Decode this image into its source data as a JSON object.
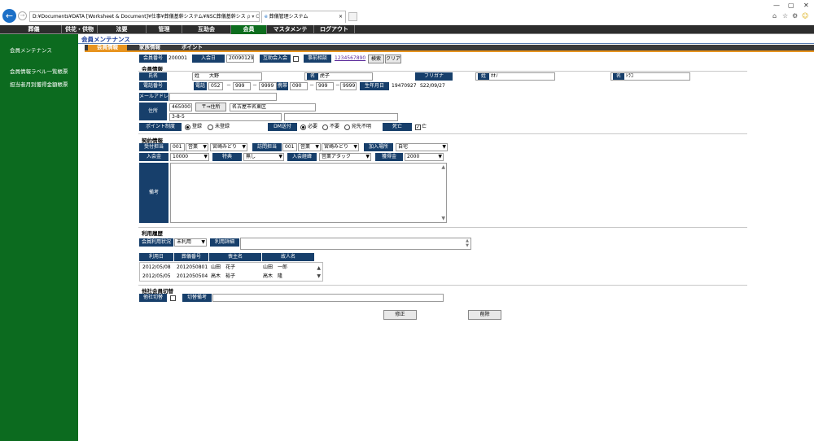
{
  "browser": {
    "address": "D:¥Documents¥DATA [Worksheet & Document]¥仕事¥葬儀基幹システム¥NSC葬儀基幹シス",
    "addr_icons": "ρ ▾ C",
    "tab_title": "葬儀管理システム",
    "tab_close": "×",
    "win_min": "—",
    "win_max": "▢",
    "win_close": "✕",
    "toolbar_icons": [
      "⌂",
      "☆",
      "⚙",
      "☺"
    ]
  },
  "menu": [
    "葬儀",
    "供花・供物",
    "法要",
    "管理",
    "互助会",
    "会員",
    "マスタメンテ",
    "ログアウト"
  ],
  "sidebar": [
    "会員メンテナンス",
    "会員情報ラベル一覧帳票",
    "担当者月別獲得金額帳票"
  ],
  "page": {
    "title": "会員メンテナンス",
    "subtabs": [
      "会員情報",
      "家族情報",
      "ポイント"
    ]
  },
  "header": {
    "member_no_label": "会員番号",
    "member_no": "200001",
    "join_date_label": "入会日",
    "join_date": "20090129",
    "mutual_label": "互助会入会",
    "pre_consult_label": "事前相談",
    "pre_consult_link": "1234567890",
    "search_btn": "検索",
    "clear_btn": "クリア"
  },
  "member": {
    "section": "会員情報",
    "name_label": "氏名",
    "sei_label": "姓",
    "sei": "大野",
    "mei_label": "名",
    "mei": "虎子",
    "kana_label": "フリガナ",
    "kana_sei_label": "姓",
    "kana_sei": "ｵｵﾉ",
    "kana_mei_label": "名",
    "kana_mei": "ﾄﾗｺ",
    "phone_label": "電話番号",
    "tel_label": "電話",
    "tel": [
      "052",
      "999",
      "9999"
    ],
    "mobile_label": "携帯",
    "mobile": [
      "090",
      "999",
      "9999"
    ],
    "dash": "－",
    "birth_label": "生年月日",
    "birth": "19470927",
    "birth_wareki": "S22/09/27",
    "mail_label": "メールアドレス",
    "address_label": "住所",
    "zip": "4650001",
    "zip_btn": "〒⇒住所",
    "addr1": "名古屋市名東区",
    "addr2": "3-8-5",
    "point_label": "ポイント制度",
    "point_opts": [
      "登録",
      "未登録"
    ],
    "dm_label": "DM送付",
    "dm_opts": [
      "必要",
      "不要",
      "宛先不明"
    ],
    "death_label": "死亡",
    "death_text": "亡"
  },
  "contract": {
    "section": "契約情報",
    "reception_label": "受付担当",
    "reception_code": "001",
    "reception_dept": "営業",
    "reception_person": "宮崎みどり",
    "visit_label": "訪問担当",
    "visit_code": "001",
    "visit_dept": "営業",
    "visit_person": "宮崎みどり",
    "join_place_label": "加入場所",
    "join_place": "自宅",
    "join_fee_label": "入会金",
    "join_fee": "10000",
    "benefit_label": "特典",
    "benefit": "無し",
    "join_route_label": "入会経緯",
    "join_route": "営業アタック",
    "acquire_label": "獲得金",
    "acquire": "2000",
    "remarks_label": "備考"
  },
  "usage": {
    "section": "利用履歴",
    "status_label": "会員利用状況",
    "status": "未利用",
    "detail_label": "利用詳細",
    "cols": [
      "利用日",
      "葬儀番号",
      "喪主名",
      "故人名"
    ],
    "rows": [
      [
        "2012/05/08",
        "2012050801",
        "山田　花子",
        "山田　一郎"
      ],
      [
        "2012/05/05",
        "2012050504",
        "高木　裕子",
        "高木　隆"
      ]
    ]
  },
  "switch": {
    "section": "他社会員切替",
    "other_label": "他社切替",
    "note_label": "切替備考"
  },
  "actions": {
    "save": "修正",
    "delete": "削除"
  }
}
